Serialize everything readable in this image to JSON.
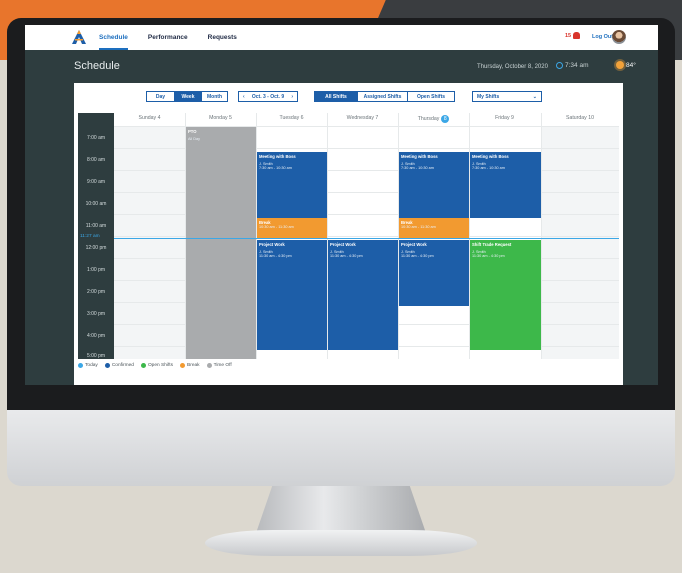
{
  "nav": {
    "items": [
      "Schedule",
      "Performance",
      "Requests"
    ],
    "active": "Schedule"
  },
  "topbar": {
    "notifications": "15",
    "logout": "Log Out"
  },
  "header": {
    "title": "Schedule",
    "date": "Thursday, October 8, 2020",
    "time": "7:34 am",
    "temperature": "84°"
  },
  "view": {
    "options": [
      "Day",
      "Week",
      "Month"
    ],
    "active": "Week",
    "range": "Oct. 3 - Oct. 9"
  },
  "filters": {
    "options": [
      "All Shifts",
      "Assigned Shifts",
      "Open Shifts"
    ],
    "active": "All Shifts",
    "select": "My Shifts"
  },
  "days": [
    "Sunday 4",
    "Monday 5",
    "Tuesday 6",
    "Wednesday 7",
    "Thursday",
    "Friday 9",
    "Saturday 10"
  ],
  "thursday_num": "8",
  "hours": [
    "7:00 am",
    "8:00 am",
    "9:00 am",
    "10:00 am",
    "11:00 am",
    "12:00 pm",
    "1:00 pm",
    "2:00 pm",
    "3:00 pm",
    "4:00 pm",
    "5:00 pm"
  ],
  "now": "11:27 am",
  "events": {
    "pto": {
      "title": "PTO",
      "sub": "All Day"
    },
    "meeting": {
      "title": "Meeting with Boss",
      "name": "J. Smith",
      "time": "7:30 am - 10:30 am"
    },
    "break": {
      "title": "Break",
      "time": "10:30 am - 11:30 am"
    },
    "project": {
      "title": "Project Work",
      "name": "J. Smith",
      "time": "11:30 am - 4:30 pm"
    },
    "trade": {
      "title": "Shift Trade Request",
      "name": "J. Smith",
      "time": "11:30 am - 4:30 pm"
    }
  },
  "legend": [
    "Today",
    "Confirmed",
    "Open Shifts",
    "Break",
    "Time Off"
  ],
  "colors": {
    "today": "#3ba7e6",
    "confirmed": "#1d5ea8",
    "open": "#3db84a",
    "break": "#f29a30",
    "timeoff": "#a9abad"
  }
}
